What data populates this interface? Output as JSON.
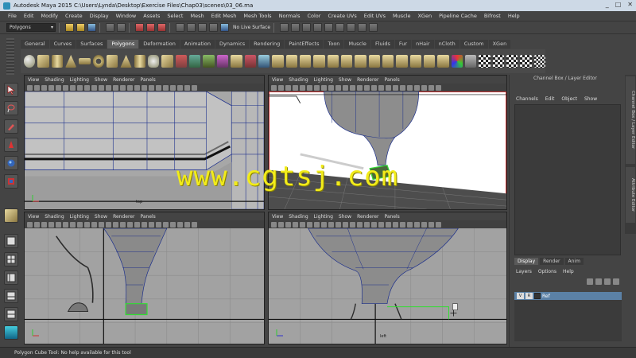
{
  "window": {
    "title": "Autodesk Maya 2015   C:\\Users\\Lynda\\Desktop\\Exercise Files\\Chap03\\scenes\\03_06.ma",
    "controls": [
      "_",
      "□",
      "✕"
    ]
  },
  "menubar": [
    "File",
    "Edit",
    "Modify",
    "Create",
    "Display",
    "Window",
    "Assets",
    "Select",
    "Mesh",
    "Edit Mesh",
    "Mesh Tools",
    "Normals",
    "Color",
    "Create UVs",
    "Edit UVs",
    "Muscle",
    "XGen",
    "Pipeline Cache",
    "Bifrost",
    "Help"
  ],
  "statusline": {
    "mode": "Polygons",
    "live_surface": "No Live Surface"
  },
  "shelf": {
    "tabs": [
      "General",
      "Curves",
      "Surfaces",
      "Polygons",
      "Deformation",
      "Animation",
      "Dynamics",
      "Rendering",
      "PaintEffects",
      "Toon",
      "Muscle",
      "Fluids",
      "Fur",
      "nHair",
      "nCloth",
      "Custom",
      "XGen"
    ],
    "active_tab": "Polygons"
  },
  "viewport_menu": [
    "View",
    "Shading",
    "Lighting",
    "Show",
    "Renderer",
    "Panels"
  ],
  "viewports": {
    "top_left_label": "top",
    "bottom_right_label": "left"
  },
  "channel_box": {
    "title": "Channel Box / Layer Editor",
    "menu": [
      "Channels",
      "Edit",
      "Object",
      "Show"
    ]
  },
  "layer_editor": {
    "tabs": [
      "Display",
      "Render",
      "Anim"
    ],
    "active_tab": "Display",
    "menu": [
      "Layers",
      "Options",
      "Help"
    ],
    "layer": {
      "v": "V",
      "r": "R",
      "name": "Ref"
    }
  },
  "side_tabs": [
    "Channel Box / Layer Editor",
    "Attribute Editor"
  ],
  "helpline": "Polygon Cube Tool: No help available for this tool",
  "watermark": "www.cgtsj.com",
  "colors": {
    "accent": "#5b81a6",
    "wire": "#1c2f8c",
    "selected": "#33dd33",
    "watermark": "#f2ec1a"
  }
}
